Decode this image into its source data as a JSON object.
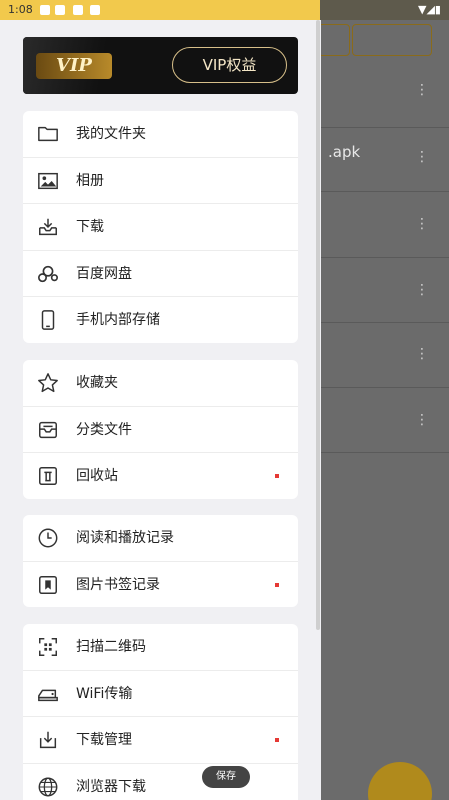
{
  "status_bar": {
    "time": "1:08",
    "right": "▼◢▮"
  },
  "background": {
    "tab_right": "···",
    "file_text": ".apk"
  },
  "vip": {
    "badge": "VIP",
    "button": "VIP权益"
  },
  "groups": [
    {
      "items": [
        {
          "label": "我的文件夹",
          "icon": "folder-icon",
          "dot": false
        },
        {
          "label": "相册",
          "icon": "image-icon",
          "dot": false
        },
        {
          "label": "下载",
          "icon": "download-tray-icon",
          "dot": false
        },
        {
          "label": "百度网盘",
          "icon": "cloud-disk-icon",
          "dot": false
        },
        {
          "label": "手机内部存储",
          "icon": "phone-icon",
          "dot": false
        }
      ]
    },
    {
      "items": [
        {
          "label": "收藏夹",
          "icon": "star-icon",
          "dot": false
        },
        {
          "label": "分类文件",
          "icon": "category-box-icon",
          "dot": false
        },
        {
          "label": "回收站",
          "icon": "trash-icon",
          "dot": true
        }
      ]
    },
    {
      "items": [
        {
          "label": "阅读和播放记录",
          "icon": "clock-icon",
          "dot": false
        },
        {
          "label": "图片书签记录",
          "icon": "bookmark-icon",
          "dot": true
        }
      ]
    },
    {
      "items": [
        {
          "label": "扫描二维码",
          "icon": "qr-scan-icon",
          "dot": false
        },
        {
          "label": "WiFi传输",
          "icon": "wifi-transfer-icon",
          "dot": false
        },
        {
          "label": "下载管理",
          "icon": "download-manage-icon",
          "dot": true
        },
        {
          "label": "浏览器下载",
          "icon": "globe-icon",
          "dot": false
        }
      ]
    }
  ],
  "toast": "保存",
  "colors": {
    "accent": "#f2c94c",
    "dot": "#e53935"
  }
}
